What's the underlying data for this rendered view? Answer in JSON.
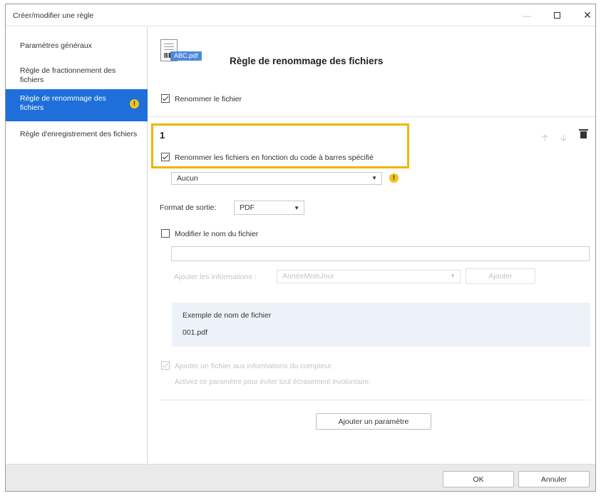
{
  "window": {
    "title": "Créer/modifier une règle",
    "minimize_glyph": "—",
    "close_glyph": "✕"
  },
  "sidebar": {
    "items": [
      {
        "label": "Paramètres généraux",
        "selected": false
      },
      {
        "label": "Règle de fractionnement des fichiers",
        "selected": false
      },
      {
        "label": "Règle de renommage des fichiers",
        "selected": true,
        "warning": "!"
      },
      {
        "label": "Règle d'enregistrement des fichiers",
        "selected": false
      }
    ]
  },
  "header": {
    "file_badge": "ABC.pdf",
    "title": "Règle de renommage des fichiers"
  },
  "rename_file": {
    "label": "Renommer le fichier",
    "checked": true
  },
  "rule": {
    "number": "1",
    "icons": {
      "up": "up-arrow-icon",
      "down": "down-arrow-icon",
      "delete": "trash-icon"
    },
    "barcode_rename": {
      "label": "Renommer les fichiers en fonction du code à barres spécifié",
      "checked": true
    },
    "barcode_select": {
      "value": "Aucun",
      "warning": "!"
    },
    "output_format": {
      "label": "Format de sortie:",
      "value": "PDF"
    },
    "modify_name": {
      "label": "Modifier le nom du fichier",
      "checked": false
    },
    "name_field": {
      "value": ""
    },
    "add_info": {
      "label": "Ajouter les informations :",
      "select_value": "AnnéeMoisJour",
      "button": "Ajouter"
    },
    "example": {
      "label": "Exemple de nom de fichier",
      "value": "001.pdf"
    },
    "counter": {
      "label": "Ajouter un fichier aux informations du compteur.",
      "hint": "Activez ce paramètre pour éviter tout écrasement involontaire.",
      "checked": true,
      "disabled": true
    },
    "add_param_button": "Ajouter un paramètre"
  },
  "footer": {
    "ok": "OK",
    "cancel": "Annuler"
  },
  "colors": {
    "accent": "#1e6fd9",
    "highlight": "#f0b400",
    "warning": "#f0c419",
    "example_bg": "#edf2f8"
  }
}
